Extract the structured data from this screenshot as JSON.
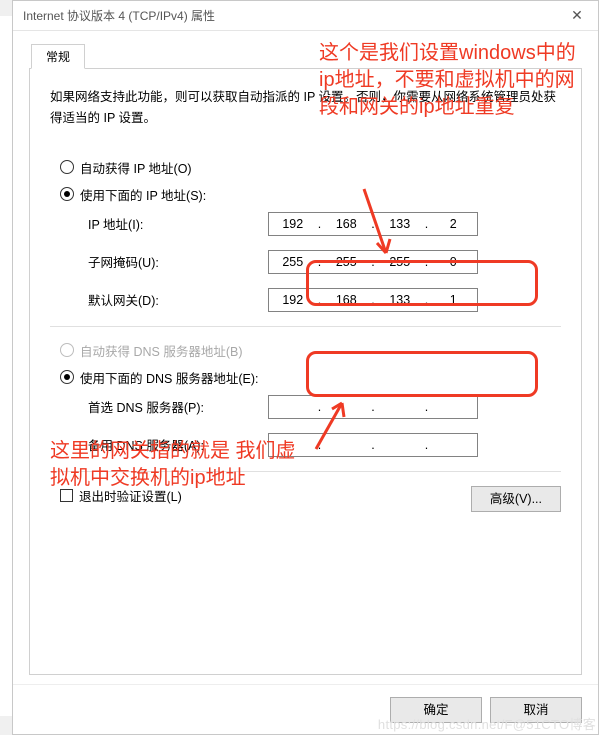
{
  "window": {
    "title": "Internet 协议版本 4 (TCP/IPv4) 属性",
    "close_glyph": "✕"
  },
  "tab": {
    "label": "常规"
  },
  "description": "如果网络支持此功能，则可以获取自动指派的 IP 设置。否则，你需要从网络系统管理员处获得适当的 IP 设置。",
  "ip_section": {
    "auto_label": "自动获得 IP 地址(O)",
    "manual_label": "使用下面的 IP 地址(S):",
    "ip_label": "IP 地址(I):",
    "ip_value": [
      "192",
      "168",
      "133",
      "2"
    ],
    "mask_label": "子网掩码(U):",
    "mask_value": [
      "255",
      "255",
      "255",
      "0"
    ],
    "gw_label": "默认网关(D):",
    "gw_value": [
      "192",
      "168",
      "133",
      "1"
    ]
  },
  "dns_section": {
    "auto_label": "自动获得 DNS 服务器地址(B)",
    "manual_label": "使用下面的 DNS 服务器地址(E):",
    "pref_label": "首选 DNS 服务器(P):",
    "pref_value": [
      "",
      "",
      "",
      ""
    ],
    "alt_label": "备用 DNS 服务器(A):",
    "alt_value": [
      "",
      "",
      "",
      ""
    ]
  },
  "validate_label": "退出时验证设置(L)",
  "advanced_label": "高级(V)...",
  "buttons": {
    "ok": "确定",
    "cancel": "取消"
  },
  "annotations": {
    "top": "这个是我们设置windows中的ip地址，不要和虚拟机中的网段和网关的ip地址重复",
    "mid": "这里的网关指的就是 我们虚拟机中交换机的ip地址"
  },
  "watermark": "https://blog.csdn.net/F@51CTO博客"
}
